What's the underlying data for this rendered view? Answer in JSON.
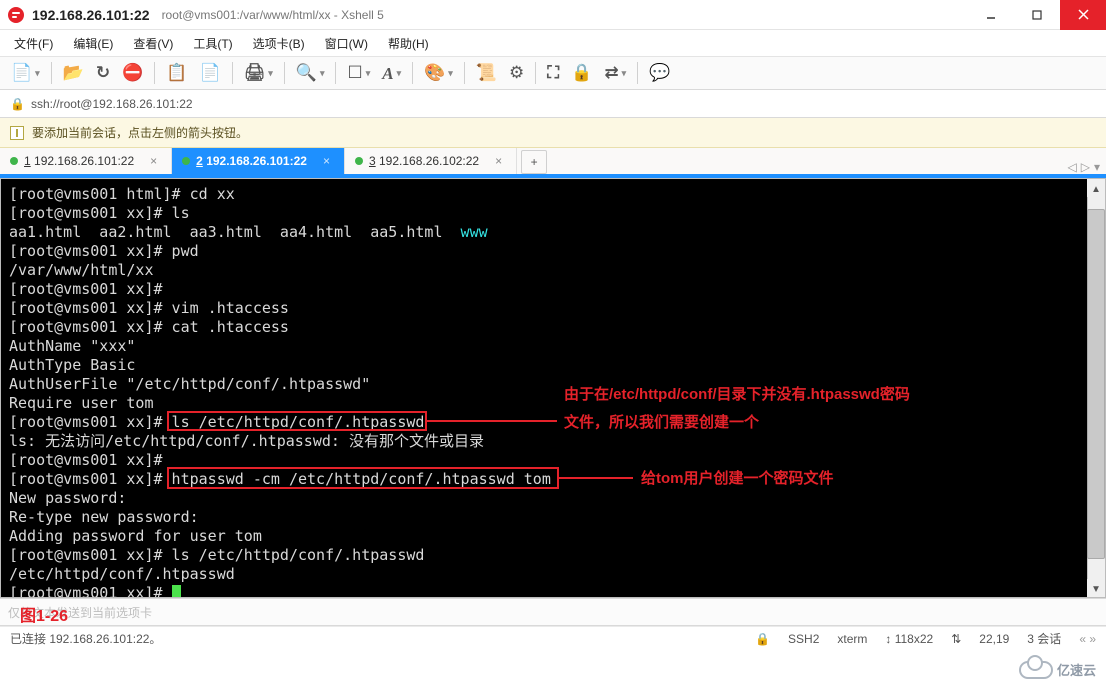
{
  "window": {
    "title_main": "192.168.26.101:22",
    "title_sub": "root@vms001:/var/www/html/xx - Xshell 5"
  },
  "menu": {
    "file": "文件(F)",
    "edit": "编辑(E)",
    "view": "查看(V)",
    "tools": "工具(T)",
    "tabs": "选项卡(B)",
    "window": "窗口(W)",
    "help": "帮助(H)"
  },
  "addressbar": {
    "url": "ssh://root@192.168.26.101:22"
  },
  "infobar": {
    "text": "要添加当前会话，点击左侧的箭头按钮。"
  },
  "tabs": [
    {
      "num": "1",
      "label": "192.168.26.101:22",
      "active": false
    },
    {
      "num": "2",
      "label": "192.168.26.101:22",
      "active": true
    },
    {
      "num": "3",
      "label": "192.168.26.102:22",
      "active": false
    }
  ],
  "terminal": {
    "lines": [
      "[root@vms001 html]# cd xx",
      "[root@vms001 xx]# ls",
      "aa1.html  aa2.html  aa3.html  aa4.html  aa5.html  www",
      "[root@vms001 xx]# pwd",
      "/var/www/html/xx",
      "[root@vms001 xx]#",
      "[root@vms001 xx]# vim .htaccess",
      "[root@vms001 xx]# cat .htaccess",
      "AuthName \"xxx\"",
      "AuthType Basic",
      "AuthUserFile \"/etc/httpd/conf/.htpasswd\"",
      "Require user tom",
      "[root@vms001 xx]# ls /etc/httpd/conf/.htpasswd",
      "ls: 无法访问/etc/httpd/conf/.htpasswd: 没有那个文件或目录",
      "[root@vms001 xx]#",
      "[root@vms001 xx]# htpasswd -cm /etc/httpd/conf/.htpasswd tom",
      "New password:",
      "Re-type new password:",
      "Adding password for user tom",
      "[root@vms001 xx]# ls /etc/httpd/conf/.htpasswd",
      "/etc/httpd/conf/.htpasswd",
      "[root@vms001 xx]# "
    ],
    "www_token": "www"
  },
  "annotations": {
    "a1_line1": "由于在/etc/httpd/conf/目录下并没有.htpasswd密码",
    "a1_line2": "文件，所以我们需要创建一个",
    "a2": "给tom用户创建一个密码文件",
    "fig": "图1-26"
  },
  "inputstrip": {
    "placeholder": "仅将文本发送到当前选项卡"
  },
  "status": {
    "left": "已连接 192.168.26.101:22。",
    "ssh": "SSH2",
    "term": "xterm",
    "size": "118x22",
    "pos": "22,19",
    "sessions": "3 会话"
  },
  "watermark": {
    "text": "亿速云"
  }
}
